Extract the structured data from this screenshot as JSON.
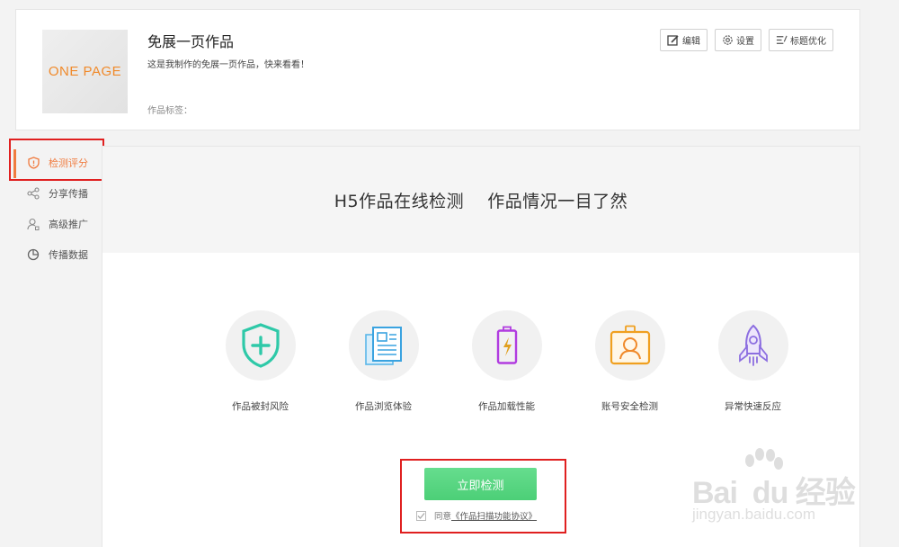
{
  "header": {
    "cover_text": "ONE PAGE",
    "title": "免展一页作品",
    "description": "这是我制作的免展一页作品，快来看看！",
    "tags_label": "作品标签："
  },
  "toolbar": {
    "edit_label": "编辑",
    "settings_label": "设置",
    "title_opt_label": "标题优化"
  },
  "sidebar": {
    "items": [
      {
        "label": "检测评分",
        "icon": "shield-icon",
        "active": true
      },
      {
        "label": "分享传播",
        "icon": "share-icon",
        "active": false
      },
      {
        "label": "高级推广",
        "icon": "user-icon",
        "active": false
      },
      {
        "label": "传播数据",
        "icon": "pie-chart-icon",
        "active": false
      }
    ]
  },
  "main": {
    "banner_title": "H5作品在线检测    作品情况一目了然",
    "features": [
      {
        "label": "作品被封风险",
        "icon": "shield-plus-icon"
      },
      {
        "label": "作品浏览体验",
        "icon": "document-icon"
      },
      {
        "label": "作品加载性能",
        "icon": "battery-icon"
      },
      {
        "label": "账号安全检测",
        "icon": "id-badge-icon"
      },
      {
        "label": "异常快速反应",
        "icon": "rocket-icon"
      }
    ],
    "check_button": "立即检测",
    "agree_prefix": "同意",
    "agree_link": "《作品扫描功能协议》"
  },
  "watermark": {
    "main": "Bai  du 经验",
    "sub": "jingyan.baidu.com"
  },
  "colors": {
    "accent": "#f07b3f",
    "button_green": "#52d27c",
    "highlight_red": "#e02020"
  }
}
